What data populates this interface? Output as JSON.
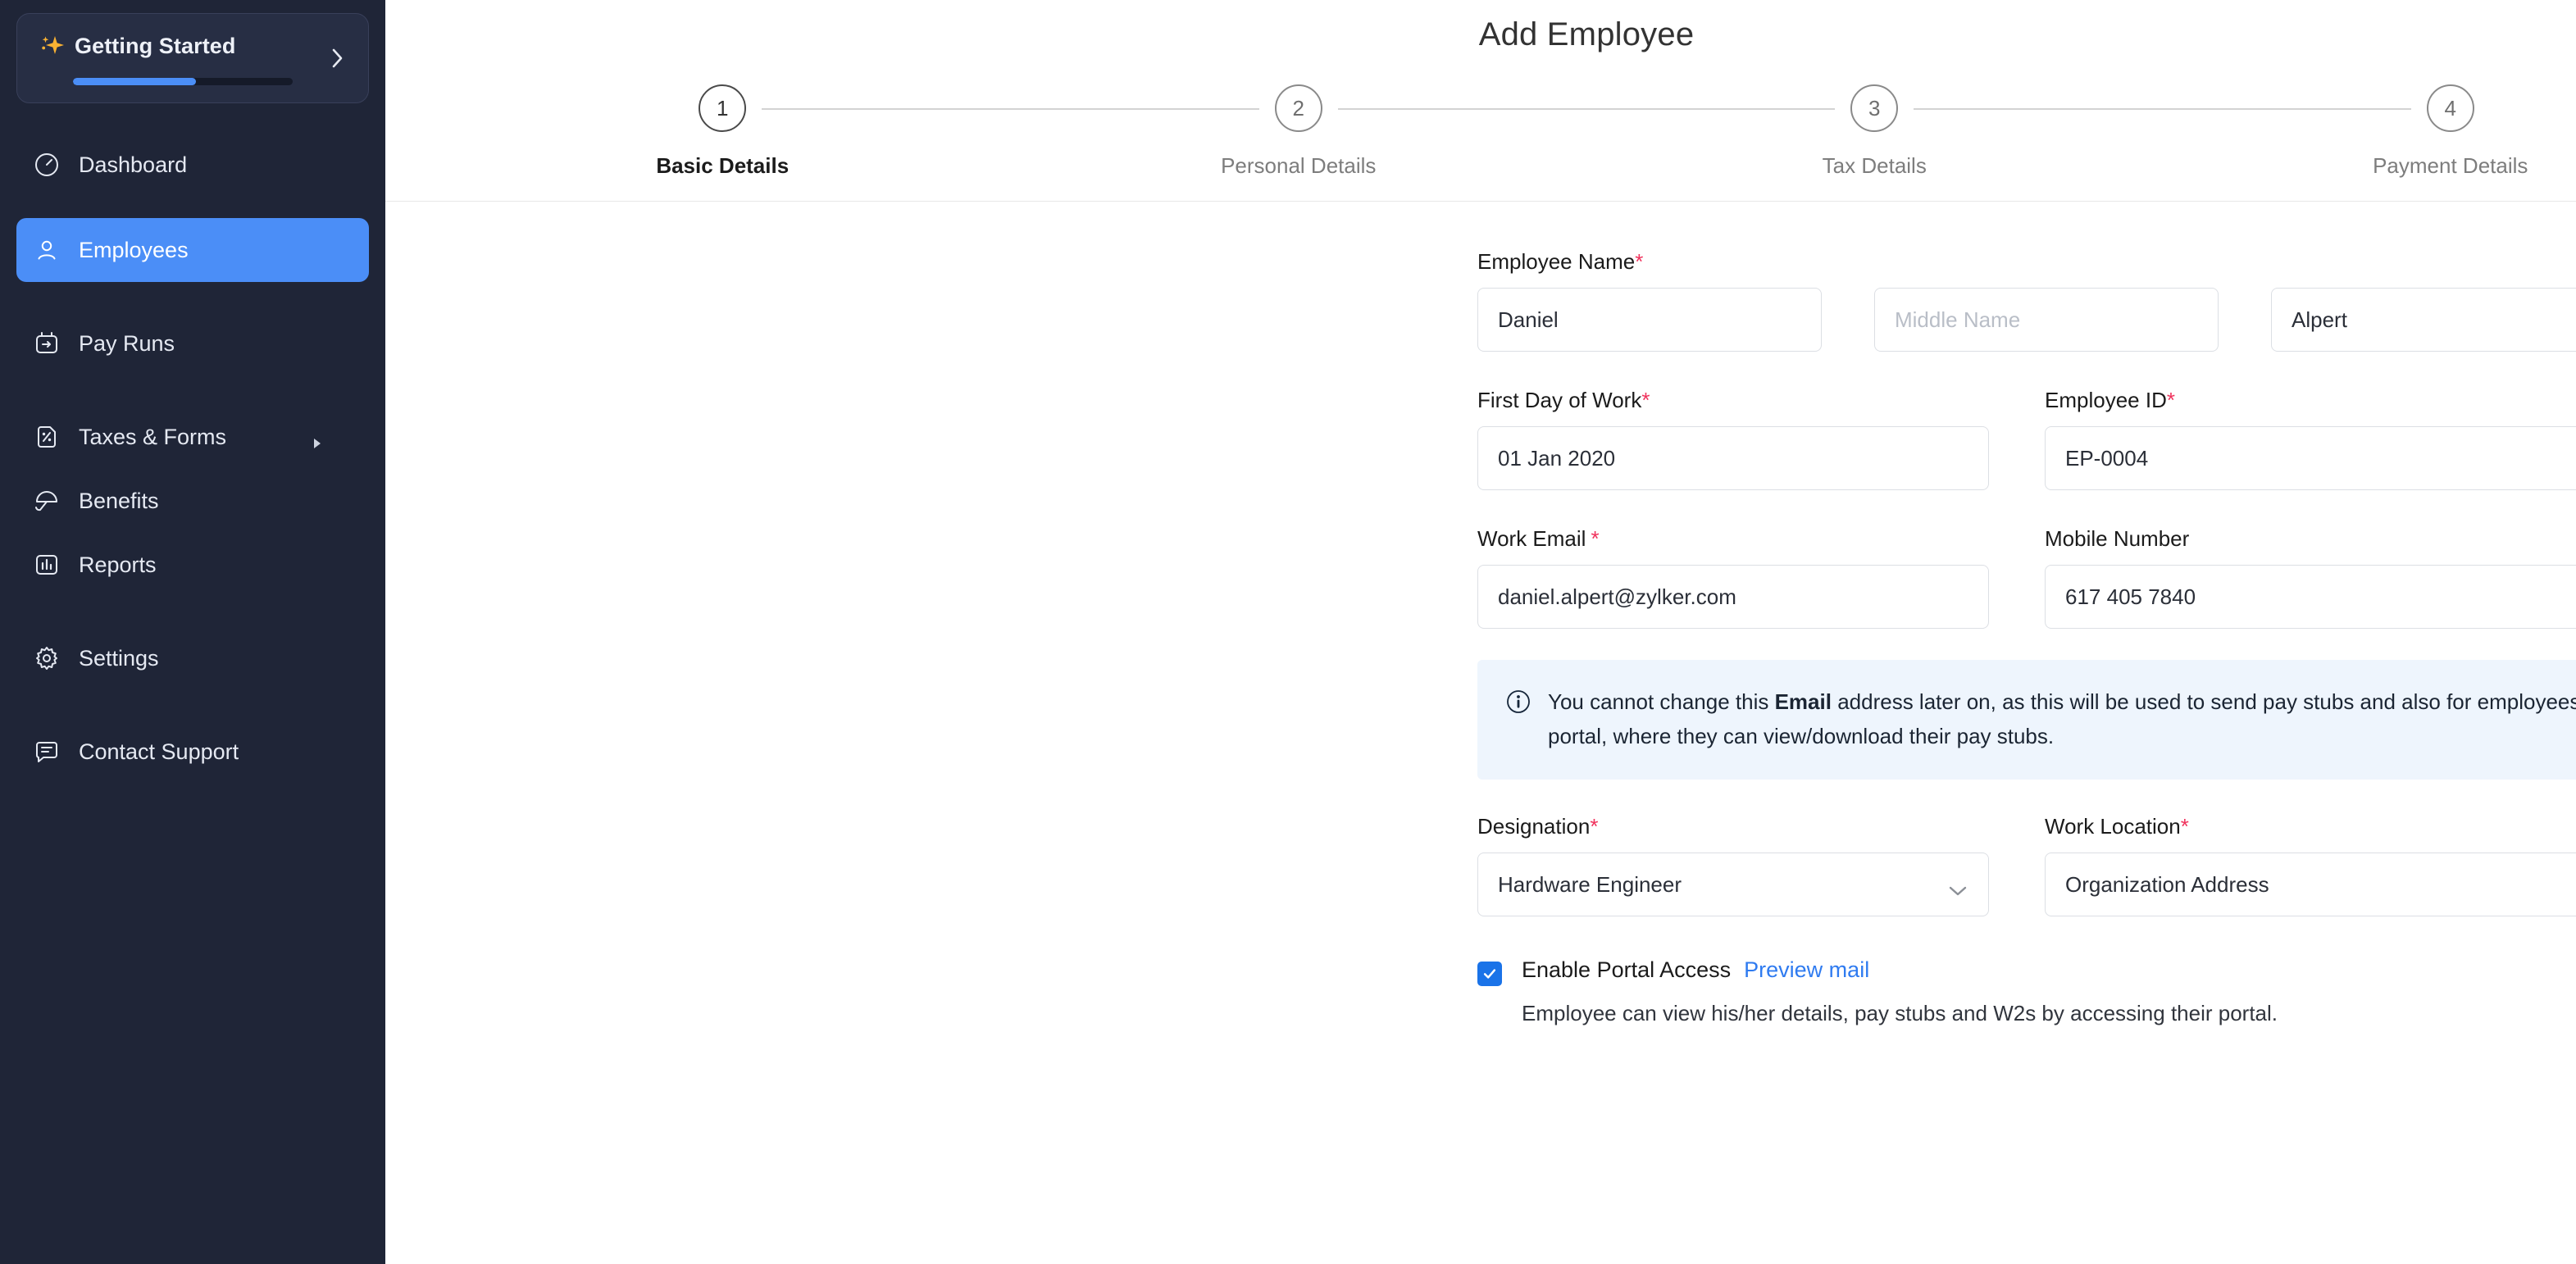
{
  "sidebar": {
    "getting_started": {
      "label": "Getting Started",
      "progress_percent": 56,
      "spark_icon": "sparkle-icon",
      "chevron_icon": "chevron-right-icon"
    },
    "items": [
      {
        "label": "Dashboard",
        "icon": "speedometer-icon",
        "active": false,
        "gap_after": "lg"
      },
      {
        "label": "Employees",
        "icon": "person-icon",
        "active": true,
        "gap_after": "xl"
      },
      {
        "label": "Pay Runs",
        "icon": "calendar-arrow-icon",
        "active": false,
        "gap_after": "xl"
      },
      {
        "label": "Taxes & Forms",
        "icon": "percent-doc-icon",
        "active": false,
        "gap_after": "sm",
        "caret": true
      },
      {
        "label": "Benefits",
        "icon": "umbrella-icon",
        "active": false,
        "gap_after": "sm"
      },
      {
        "label": "Reports",
        "icon": "bar-chart-icon",
        "active": false,
        "gap_after": "xl"
      },
      {
        "label": "Settings",
        "icon": "gear-icon",
        "active": false,
        "gap_after": "xl"
      },
      {
        "label": "Contact Support",
        "icon": "chat-icon",
        "active": false,
        "gap_after": "sm"
      }
    ]
  },
  "header": {
    "title": "Add Employee"
  },
  "stepper": {
    "steps": [
      {
        "number": "1",
        "label": "Basic Details",
        "active": true
      },
      {
        "number": "2",
        "label": "Personal Details",
        "active": false
      },
      {
        "number": "3",
        "label": "Tax Details",
        "active": false
      },
      {
        "number": "4",
        "label": "Payment Details",
        "active": false
      }
    ]
  },
  "form": {
    "employee_name": {
      "label": "Employee Name",
      "required_mark": "*",
      "first": "Daniel",
      "middle_placeholder": "Middle Name",
      "middle": "",
      "last": "Alpert"
    },
    "first_day": {
      "label": "First Day of Work",
      "required_mark": "*",
      "value": "01 Jan 2020"
    },
    "employee_id": {
      "label": "Employee ID",
      "required_mark": "*",
      "value": "EP-0004"
    },
    "work_email": {
      "label": "Work Email",
      "required_mark": "*",
      "value": "daniel.alpert@zylker.com"
    },
    "mobile_number": {
      "label": "Mobile Number",
      "required_mark": "",
      "value": "617 405 7840"
    },
    "notice": {
      "icon": "info-circle-icon",
      "text_before": "You cannot change this ",
      "text_bold": "Email",
      "text_after": " address later on, as this will be used to send pay stubs and also for employees to sign in to their portal, where they can view/download their pay stubs."
    },
    "designation": {
      "label": "Designation",
      "required_mark": "*",
      "value": "Hardware Engineer",
      "chevron_icon": "chevron-down-icon"
    },
    "work_location": {
      "label": "Work Location",
      "required_mark": "*",
      "value": "Organization Address",
      "chevron_icon": "chevron-down-icon"
    },
    "portal_access": {
      "checked": true,
      "check_icon": "check-icon",
      "label": "Enable Portal Access",
      "link": "Preview mail",
      "description": "Employee can view his/her details, pay stubs and W2s by accessing their portal."
    }
  },
  "colors": {
    "sidebar_bg": "#1f2537",
    "sidebar_card_bg": "#272e44",
    "accent_blue": "#4b8ef7",
    "link_blue": "#2f7bf0",
    "checkbox_blue": "#1a73e8",
    "required_red": "#f0325c",
    "notice_bg": "#eef5fd",
    "spark_gold": "#f9b233"
  }
}
